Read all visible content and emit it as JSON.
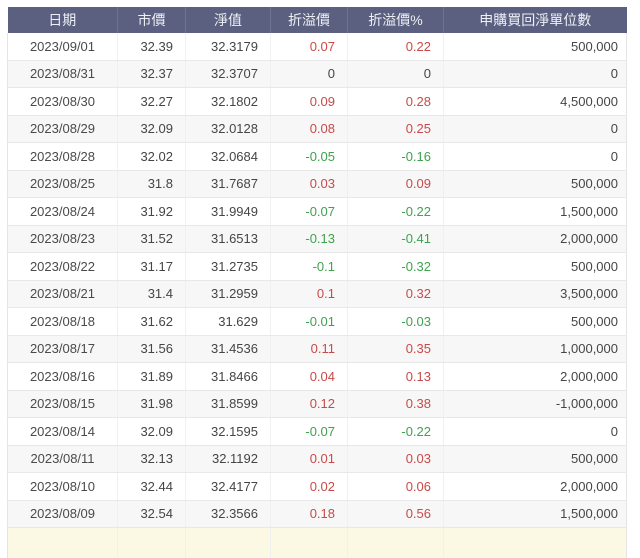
{
  "table": {
    "columns": [
      {
        "key": "date",
        "label": "日期"
      },
      {
        "key": "market_price",
        "label": "市價"
      },
      {
        "key": "nav",
        "label": "淨值"
      },
      {
        "key": "premium",
        "label": "折溢價"
      },
      {
        "key": "premium_pct",
        "label": "折溢價%"
      },
      {
        "key": "net_units",
        "label": "申購買回淨單位數"
      }
    ],
    "rows": [
      {
        "date": "2023/09/01",
        "market_price": "32.39",
        "nav": "32.3179",
        "premium": "0.07",
        "premium_pct": "0.22",
        "net_units": "500,000"
      },
      {
        "date": "2023/08/31",
        "market_price": "32.37",
        "nav": "32.3707",
        "premium": "0",
        "premium_pct": "0",
        "net_units": "0"
      },
      {
        "date": "2023/08/30",
        "market_price": "32.27",
        "nav": "32.1802",
        "premium": "0.09",
        "premium_pct": "0.28",
        "net_units": "4,500,000"
      },
      {
        "date": "2023/08/29",
        "market_price": "32.09",
        "nav": "32.0128",
        "premium": "0.08",
        "premium_pct": "0.25",
        "net_units": "0"
      },
      {
        "date": "2023/08/28",
        "market_price": "32.02",
        "nav": "32.0684",
        "premium": "-0.05",
        "premium_pct": "-0.16",
        "net_units": "0"
      },
      {
        "date": "2023/08/25",
        "market_price": "31.8",
        "nav": "31.7687",
        "premium": "0.03",
        "premium_pct": "0.09",
        "net_units": "500,000"
      },
      {
        "date": "2023/08/24",
        "market_price": "31.92",
        "nav": "31.9949",
        "premium": "-0.07",
        "premium_pct": "-0.22",
        "net_units": "1,500,000"
      },
      {
        "date": "2023/08/23",
        "market_price": "31.52",
        "nav": "31.6513",
        "premium": "-0.13",
        "premium_pct": "-0.41",
        "net_units": "2,000,000"
      },
      {
        "date": "2023/08/22",
        "market_price": "31.17",
        "nav": "31.2735",
        "premium": "-0.1",
        "premium_pct": "-0.32",
        "net_units": "500,000"
      },
      {
        "date": "2023/08/21",
        "market_price": "31.4",
        "nav": "31.2959",
        "premium": "0.1",
        "premium_pct": "0.32",
        "net_units": "3,500,000"
      },
      {
        "date": "2023/08/18",
        "market_price": "31.62",
        "nav": "31.629",
        "premium": "-0.01",
        "premium_pct": "-0.03",
        "net_units": "500,000"
      },
      {
        "date": "2023/08/17",
        "market_price": "31.56",
        "nav": "31.4536",
        "premium": "0.11",
        "premium_pct": "0.35",
        "net_units": "1,000,000"
      },
      {
        "date": "2023/08/16",
        "market_price": "31.89",
        "nav": "31.8466",
        "premium": "0.04",
        "premium_pct": "0.13",
        "net_units": "2,000,000"
      },
      {
        "date": "2023/08/15",
        "market_price": "31.98",
        "nav": "31.8599",
        "premium": "0.12",
        "premium_pct": "0.38",
        "net_units": "-1,000,000"
      },
      {
        "date": "2023/08/14",
        "market_price": "32.09",
        "nav": "32.1595",
        "premium": "-0.07",
        "premium_pct": "-0.22",
        "net_units": "0"
      },
      {
        "date": "2023/08/11",
        "market_price": "32.13",
        "nav": "32.1192",
        "premium": "0.01",
        "premium_pct": "0.03",
        "net_units": "500,000"
      },
      {
        "date": "2023/08/10",
        "market_price": "32.44",
        "nav": "32.4177",
        "premium": "0.02",
        "premium_pct": "0.06",
        "net_units": "2,000,000"
      },
      {
        "date": "2023/08/09",
        "market_price": "32.54",
        "nav": "32.3566",
        "premium": "0.18",
        "premium_pct": "0.56",
        "net_units": "1,500,000"
      }
    ],
    "partial_highlighted_row_visible": true
  },
  "colors": {
    "header_bg": "#5b6080",
    "header_text": "#eef0f6",
    "positive_premium_red": "#c94a48",
    "negative_premium_green": "#3fa24c",
    "alt_row_bg": "#f7f7f8",
    "highlight_row_bg": "#fbf9e4"
  }
}
